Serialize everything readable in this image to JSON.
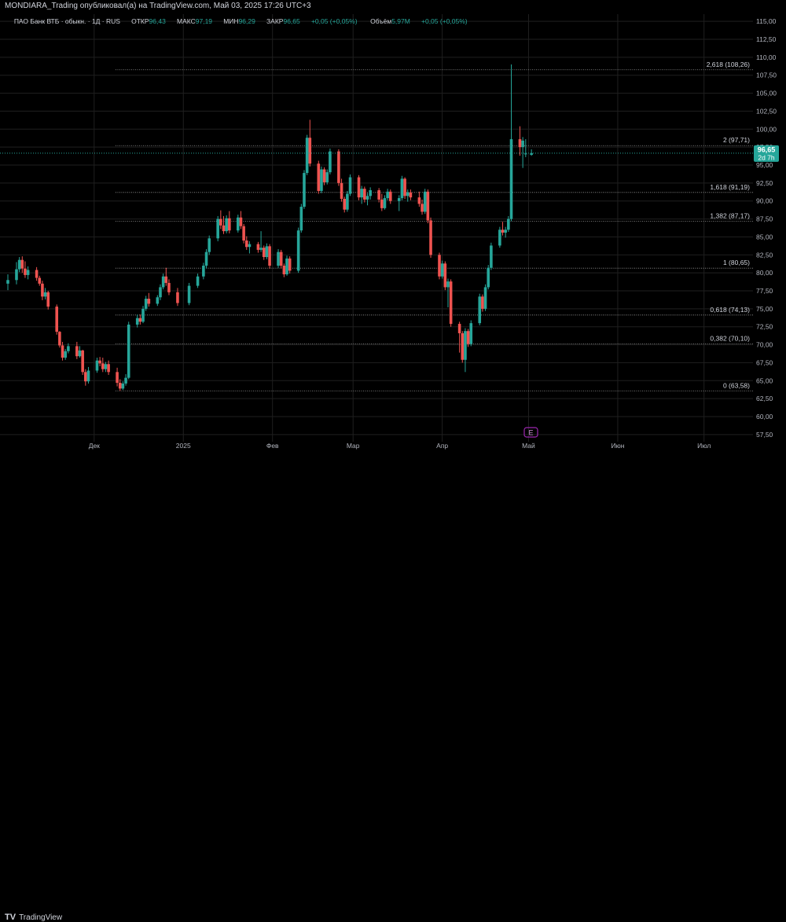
{
  "header": {
    "publish_line": "MONDIARA_Trading опубликовал(а) на TradingView.com, Май 03, 2025 17:26 UTC+3"
  },
  "legend": {
    "symbol": "ПАО Банк ВТБ · обыкн. · 1Д · RUS",
    "open_label": "ОТКР",
    "open_value": "96,43",
    "high_label": "МАКС",
    "high_value": "97,19",
    "low_label": "МИН",
    "low_value": "96,29",
    "close_label": "ЗАКР",
    "close_value": "96,65",
    "change": "+0,05 (+0,05%)",
    "volume_label": "Объём",
    "volume_value": "5,97M",
    "volume_change": "+0,05 (+0,05%)"
  },
  "price_badge": {
    "price": "96,65",
    "countdown": "2d 7h"
  },
  "earnings_marker": "E",
  "footer": {
    "brand": "TradingView"
  },
  "colors": {
    "up": "#26a69a",
    "down": "#ef5350",
    "grid": "#1f1f1f",
    "axis_text": "#b2b5be",
    "fib_line": "#9a9a9a",
    "badge_bg": "#26a69a",
    "earnings": "#9c27b0",
    "background": "#000000"
  },
  "chart_data": {
    "type": "candlestick",
    "title": "ПАО Банк ВТБ · обыкн. · 1Д · RUS",
    "yaxis": {
      "ylim": [
        56.5,
        116
      ],
      "ticks": [
        "57,50",
        "60,00",
        "62,50",
        "65,00",
        "67,50",
        "70,00",
        "72,50",
        "75,00",
        "77,50",
        "80,00",
        "82,50",
        "85,00",
        "87,50",
        "90,00",
        "92,50",
        "95,00",
        "97,50",
        "100,00",
        "102,50",
        "105,00",
        "107,50",
        "110,00",
        "112,50",
        "115,00"
      ],
      "position": "right"
    },
    "xaxis": {
      "month_labels": [
        {
          "label": "Дек",
          "date": "2024-12-01"
        },
        {
          "label": "2025",
          "date": "2025-01-01"
        },
        {
          "label": "Фев",
          "date": "2025-02-01"
        },
        {
          "label": "Мар",
          "date": "2025-03-01"
        },
        {
          "label": "Апр",
          "date": "2025-04-01"
        },
        {
          "label": "Май",
          "date": "2025-05-01"
        },
        {
          "label": "Июн",
          "date": "2025-06-01"
        },
        {
          "label": "Июл",
          "date": "2025-07-01"
        }
      ]
    },
    "fibonacci": [
      {
        "label": "2,618 (108,26)",
        "value": 108.26
      },
      {
        "label": "2 (97,71)",
        "value": 97.71
      },
      {
        "label": "1,618 (91,19)",
        "value": 91.19
      },
      {
        "label": "1,382 (87,17)",
        "value": 87.17
      },
      {
        "label": "1 (80,65)",
        "value": 80.65
      },
      {
        "label": "0,618 (74,13)",
        "value": 74.13
      },
      {
        "label": "0,382 (70,10)",
        "value": 70.1
      },
      {
        "label": "0 (63,58)",
        "value": 63.58
      }
    ],
    "last_price": 96.65,
    "candles": [
      {
        "d": "2024-11-01",
        "o": 78.5,
        "h": 79.8,
        "l": 77.6,
        "c": 79.0
      },
      {
        "d": "2024-11-04",
        "o": 79.0,
        "h": 81.5,
        "l": 78.4,
        "c": 80.5
      },
      {
        "d": "2024-11-05",
        "o": 80.5,
        "h": 82.2,
        "l": 80.1,
        "c": 81.8
      },
      {
        "d": "2024-11-06",
        "o": 81.8,
        "h": 82.3,
        "l": 80.0,
        "c": 80.6
      },
      {
        "d": "2024-11-07",
        "o": 80.6,
        "h": 81.6,
        "l": 79.3,
        "c": 79.7
      },
      {
        "d": "2024-11-08",
        "o": 79.7,
        "h": 80.9,
        "l": 79.1,
        "c": 80.4
      },
      {
        "d": "2024-11-11",
        "o": 80.4,
        "h": 80.8,
        "l": 78.9,
        "c": 79.3
      },
      {
        "d": "2024-11-12",
        "o": 79.3,
        "h": 79.6,
        "l": 78.2,
        "c": 78.5
      },
      {
        "d": "2024-11-13",
        "o": 78.5,
        "h": 78.9,
        "l": 76.2,
        "c": 76.7
      },
      {
        "d": "2024-11-14",
        "o": 76.7,
        "h": 77.9,
        "l": 76.3,
        "c": 77.3
      },
      {
        "d": "2024-11-15",
        "o": 77.3,
        "h": 77.5,
        "l": 74.9,
        "c": 75.3
      },
      {
        "d": "2024-11-18",
        "o": 75.3,
        "h": 75.6,
        "l": 71.4,
        "c": 71.8
      },
      {
        "d": "2024-11-19",
        "o": 71.8,
        "h": 71.9,
        "l": 69.6,
        "c": 69.9
      },
      {
        "d": "2024-11-20",
        "o": 69.9,
        "h": 70.4,
        "l": 67.8,
        "c": 68.2
      },
      {
        "d": "2024-11-21",
        "o": 68.2,
        "h": 69.4,
        "l": 67.9,
        "c": 69.1
      },
      {
        "d": "2024-11-22",
        "o": 69.1,
        "h": 70.2,
        "l": 68.8,
        "c": 69.8
      },
      {
        "d": "2024-11-25",
        "o": 69.8,
        "h": 70.4,
        "l": 68.0,
        "c": 68.4
      },
      {
        "d": "2024-11-26",
        "o": 68.4,
        "h": 69.8,
        "l": 68.2,
        "c": 69.2
      },
      {
        "d": "2024-11-27",
        "o": 69.2,
        "h": 69.3,
        "l": 65.8,
        "c": 66.2
      },
      {
        "d": "2024-11-28",
        "o": 66.2,
        "h": 66.6,
        "l": 64.3,
        "c": 64.9
      },
      {
        "d": "2024-11-29",
        "o": 64.9,
        "h": 66.9,
        "l": 64.6,
        "c": 66.4
      },
      {
        "d": "2024-12-02",
        "o": 66.4,
        "h": 68.2,
        "l": 66.1,
        "c": 67.8
      },
      {
        "d": "2024-12-03",
        "o": 67.8,
        "h": 68.3,
        "l": 67.0,
        "c": 67.4
      },
      {
        "d": "2024-12-04",
        "o": 67.4,
        "h": 68.2,
        "l": 66.2,
        "c": 66.6
      },
      {
        "d": "2024-12-05",
        "o": 66.6,
        "h": 67.6,
        "l": 66.2,
        "c": 67.3
      },
      {
        "d": "2024-12-06",
        "o": 67.3,
        "h": 67.8,
        "l": 65.8,
        "c": 66.2
      },
      {
        "d": "2024-12-09",
        "o": 66.2,
        "h": 66.8,
        "l": 64.2,
        "c": 64.7
      },
      {
        "d": "2024-12-10",
        "o": 64.7,
        "h": 65.2,
        "l": 63.58,
        "c": 63.9
      },
      {
        "d": "2024-12-11",
        "o": 63.9,
        "h": 64.9,
        "l": 63.7,
        "c": 64.6
      },
      {
        "d": "2024-12-12",
        "o": 64.6,
        "h": 65.9,
        "l": 64.3,
        "c": 65.4
      },
      {
        "d": "2024-12-13",
        "o": 65.4,
        "h": 73.2,
        "l": 65.2,
        "c": 72.8
      },
      {
        "d": "2024-12-16",
        "o": 72.8,
        "h": 74.2,
        "l": 72.4,
        "c": 73.7
      },
      {
        "d": "2024-12-17",
        "o": 73.7,
        "h": 74.2,
        "l": 72.8,
        "c": 73.2
      },
      {
        "d": "2024-12-18",
        "o": 73.2,
        "h": 75.4,
        "l": 73.0,
        "c": 75.0
      },
      {
        "d": "2024-12-19",
        "o": 75.0,
        "h": 76.8,
        "l": 74.7,
        "c": 76.4
      },
      {
        "d": "2024-12-20",
        "o": 76.4,
        "h": 77.2,
        "l": 75.3,
        "c": 75.7
      },
      {
        "d": "2024-12-23",
        "o": 75.7,
        "h": 76.9,
        "l": 75.4,
        "c": 76.6
      },
      {
        "d": "2024-12-24",
        "o": 76.6,
        "h": 78.4,
        "l": 76.2,
        "c": 78.0
      },
      {
        "d": "2024-12-25",
        "o": 78.0,
        "h": 79.9,
        "l": 77.7,
        "c": 79.5
      },
      {
        "d": "2024-12-26",
        "o": 79.5,
        "h": 80.7,
        "l": 78.2,
        "c": 78.6
      },
      {
        "d": "2024-12-27",
        "o": 78.6,
        "h": 79.1,
        "l": 76.9,
        "c": 77.3
      },
      {
        "d": "2024-12-30",
        "o": 77.3,
        "h": 77.9,
        "l": 75.4,
        "c": 75.8
      },
      {
        "d": "2025-01-03",
        "o": 75.8,
        "h": 78.6,
        "l": 75.5,
        "c": 78.2
      },
      {
        "d": "2025-01-06",
        "o": 78.2,
        "h": 79.9,
        "l": 77.9,
        "c": 79.5
      },
      {
        "d": "2025-01-08",
        "o": 79.5,
        "h": 81.4,
        "l": 79.1,
        "c": 81.0
      },
      {
        "d": "2025-01-09",
        "o": 81.0,
        "h": 83.3,
        "l": 80.6,
        "c": 82.9
      },
      {
        "d": "2025-01-10",
        "o": 82.9,
        "h": 85.2,
        "l": 82.5,
        "c": 84.8
      },
      {
        "d": "2025-01-13",
        "o": 84.8,
        "h": 87.9,
        "l": 84.4,
        "c": 87.5
      },
      {
        "d": "2025-01-14",
        "o": 87.5,
        "h": 88.7,
        "l": 86.1,
        "c": 86.6
      },
      {
        "d": "2025-01-15",
        "o": 86.6,
        "h": 87.9,
        "l": 85.4,
        "c": 85.8
      },
      {
        "d": "2025-01-16",
        "o": 85.8,
        "h": 88.0,
        "l": 85.5,
        "c": 87.6
      },
      {
        "d": "2025-01-17",
        "o": 87.6,
        "h": 88.6,
        "l": 85.5,
        "c": 85.9
      },
      {
        "d": "2025-01-20",
        "o": 85.9,
        "h": 88.1,
        "l": 85.6,
        "c": 87.7
      },
      {
        "d": "2025-01-21",
        "o": 87.7,
        "h": 88.6,
        "l": 86.1,
        "c": 86.5
      },
      {
        "d": "2025-01-22",
        "o": 86.5,
        "h": 86.8,
        "l": 84.1,
        "c": 84.5
      },
      {
        "d": "2025-01-23",
        "o": 84.5,
        "h": 85.1,
        "l": 83.2,
        "c": 83.6
      },
      {
        "d": "2025-01-24",
        "o": 83.6,
        "h": 84.4,
        "l": 82.7,
        "c": 84.0
      },
      {
        "d": "2025-01-27",
        "o": 84.0,
        "h": 84.3,
        "l": 82.8,
        "c": 83.2
      },
      {
        "d": "2025-01-28",
        "o": 83.2,
        "h": 85.8,
        "l": 82.9,
        "c": 83.5
      },
      {
        "d": "2025-01-29",
        "o": 83.5,
        "h": 83.8,
        "l": 81.8,
        "c": 82.2
      },
      {
        "d": "2025-01-30",
        "o": 82.2,
        "h": 84.1,
        "l": 81.9,
        "c": 83.7
      },
      {
        "d": "2025-01-31",
        "o": 83.7,
        "h": 84.0,
        "l": 80.6,
        "c": 81.0
      },
      {
        "d": "2025-02-03",
        "o": 81.0,
        "h": 83.3,
        "l": 80.7,
        "c": 82.9
      },
      {
        "d": "2025-02-04",
        "o": 82.9,
        "h": 83.2,
        "l": 80.6,
        "c": 81.0
      },
      {
        "d": "2025-02-05",
        "o": 81.0,
        "h": 81.3,
        "l": 79.4,
        "c": 79.8
      },
      {
        "d": "2025-02-06",
        "o": 79.8,
        "h": 82.4,
        "l": 79.6,
        "c": 82.0
      },
      {
        "d": "2025-02-07",
        "o": 82.0,
        "h": 82.3,
        "l": 79.9,
        "c": 80.3
      },
      {
        "d": "2025-02-10",
        "o": 80.3,
        "h": 86.3,
        "l": 80.0,
        "c": 85.9
      },
      {
        "d": "2025-02-11",
        "o": 85.9,
        "h": 89.6,
        "l": 85.6,
        "c": 89.2
      },
      {
        "d": "2025-02-12",
        "o": 89.2,
        "h": 94.3,
        "l": 88.9,
        "c": 93.9
      },
      {
        "d": "2025-02-13",
        "o": 93.9,
        "h": 99.2,
        "l": 93.6,
        "c": 98.8
      },
      {
        "d": "2025-02-14",
        "o": 98.8,
        "h": 101.3,
        "l": 94.8,
        "c": 95.2
      },
      {
        "d": "2025-02-17",
        "o": 95.2,
        "h": 95.6,
        "l": 91.0,
        "c": 91.4
      },
      {
        "d": "2025-02-18",
        "o": 91.4,
        "h": 94.8,
        "l": 91.1,
        "c": 94.4
      },
      {
        "d": "2025-02-19",
        "o": 94.4,
        "h": 94.7,
        "l": 92.2,
        "c": 92.6
      },
      {
        "d": "2025-02-20",
        "o": 92.6,
        "h": 94.4,
        "l": 92.3,
        "c": 94.0
      },
      {
        "d": "2025-02-21",
        "o": 94.0,
        "h": 97.3,
        "l": 93.7,
        "c": 96.9
      },
      {
        "d": "2025-02-24",
        "o": 96.9,
        "h": 97.2,
        "l": 92.1,
        "c": 92.5
      },
      {
        "d": "2025-02-25",
        "o": 92.5,
        "h": 93.1,
        "l": 89.9,
        "c": 90.3
      },
      {
        "d": "2025-02-26",
        "o": 90.3,
        "h": 90.6,
        "l": 88.4,
        "c": 88.8
      },
      {
        "d": "2025-02-27",
        "o": 88.8,
        "h": 91.4,
        "l": 88.5,
        "c": 91.0
      },
      {
        "d": "2025-02-28",
        "o": 91.0,
        "h": 93.7,
        "l": 90.7,
        "c": 93.3
      },
      {
        "d": "2025-03-03",
        "o": 93.3,
        "h": 93.6,
        "l": 90.1,
        "c": 90.5
      },
      {
        "d": "2025-03-04",
        "o": 90.5,
        "h": 92.1,
        "l": 89.6,
        "c": 91.7
      },
      {
        "d": "2025-03-05",
        "o": 91.7,
        "h": 92.0,
        "l": 89.8,
        "c": 90.2
      },
      {
        "d": "2025-03-06",
        "o": 90.2,
        "h": 91.1,
        "l": 89.4,
        "c": 90.7
      },
      {
        "d": "2025-03-07",
        "o": 90.7,
        "h": 91.9,
        "l": 90.2,
        "c": 91.5
      },
      {
        "d": "2025-03-10",
        "o": 91.5,
        "h": 91.8,
        "l": 89.8,
        "c": 90.2
      },
      {
        "d": "2025-03-11",
        "o": 90.2,
        "h": 91.0,
        "l": 88.6,
        "c": 89.0
      },
      {
        "d": "2025-03-12",
        "o": 89.0,
        "h": 90.8,
        "l": 88.8,
        "c": 90.4
      },
      {
        "d": "2025-03-13",
        "o": 90.4,
        "h": 91.7,
        "l": 90.1,
        "c": 91.3
      },
      {
        "d": "2025-03-14",
        "o": 91.3,
        "h": 91.6,
        "l": 89.6,
        "c": 90.0
      },
      {
        "d": "2025-03-17",
        "o": 90.0,
        "h": 90.8,
        "l": 88.6,
        "c": 90.4
      },
      {
        "d": "2025-03-18",
        "o": 90.4,
        "h": 93.5,
        "l": 90.1,
        "c": 93.1
      },
      {
        "d": "2025-03-19",
        "o": 93.1,
        "h": 93.3,
        "l": 90.3,
        "c": 90.7
      },
      {
        "d": "2025-03-20",
        "o": 90.7,
        "h": 91.6,
        "l": 89.9,
        "c": 91.2
      },
      {
        "d": "2025-03-21",
        "o": 91.2,
        "h": 91.6,
        "l": 90.1,
        "c": 90.5
      },
      {
        "d": "2025-03-24",
        "o": 90.5,
        "h": 91.3,
        "l": 89.2,
        "c": 89.6
      },
      {
        "d": "2025-03-25",
        "o": 89.6,
        "h": 90.2,
        "l": 88.1,
        "c": 88.5
      },
      {
        "d": "2025-03-26",
        "o": 88.5,
        "h": 91.7,
        "l": 88.2,
        "c": 91.3
      },
      {
        "d": "2025-03-27",
        "o": 91.3,
        "h": 91.6,
        "l": 86.9,
        "c": 87.3
      },
      {
        "d": "2025-03-28",
        "o": 87.3,
        "h": 87.7,
        "l": 82.1,
        "c": 82.5
      },
      {
        "d": "2025-03-31",
        "o": 82.5,
        "h": 82.8,
        "l": 79.1,
        "c": 79.5
      },
      {
        "d": "2025-04-01",
        "o": 79.5,
        "h": 81.7,
        "l": 79.2,
        "c": 81.3
      },
      {
        "d": "2025-04-02",
        "o": 81.3,
        "h": 81.6,
        "l": 77.6,
        "c": 78.0
      },
      {
        "d": "2025-04-03",
        "o": 78.0,
        "h": 79.2,
        "l": 75.2,
        "c": 78.8
      },
      {
        "d": "2025-04-04",
        "o": 78.8,
        "h": 79.1,
        "l": 72.5,
        "c": 72.9
      },
      {
        "d": "2025-04-07",
        "o": 72.9,
        "h": 73.2,
        "l": 68.9,
        "c": 71.6
      },
      {
        "d": "2025-04-08",
        "o": 71.6,
        "h": 71.9,
        "l": 67.5,
        "c": 67.9
      },
      {
        "d": "2025-04-09",
        "o": 67.9,
        "h": 72.3,
        "l": 66.2,
        "c": 71.9
      },
      {
        "d": "2025-04-10",
        "o": 71.9,
        "h": 72.2,
        "l": 69.7,
        "c": 70.1
      },
      {
        "d": "2025-04-11",
        "o": 70.1,
        "h": 73.4,
        "l": 69.8,
        "c": 73.0
      },
      {
        "d": "2025-04-14",
        "o": 73.0,
        "h": 77.1,
        "l": 72.7,
        "c": 76.7
      },
      {
        "d": "2025-04-15",
        "o": 76.7,
        "h": 77.0,
        "l": 74.6,
        "c": 75.0
      },
      {
        "d": "2025-04-16",
        "o": 75.0,
        "h": 78.4,
        "l": 74.7,
        "c": 78.0
      },
      {
        "d": "2025-04-17",
        "o": 78.0,
        "h": 81.1,
        "l": 77.7,
        "c": 80.7
      },
      {
        "d": "2025-04-18",
        "o": 80.7,
        "h": 84.2,
        "l": 80.4,
        "c": 83.8
      },
      {
        "d": "2025-04-21",
        "o": 83.8,
        "h": 86.4,
        "l": 83.5,
        "c": 86.0
      },
      {
        "d": "2025-04-22",
        "o": 86.0,
        "h": 87.1,
        "l": 85.2,
        "c": 85.6
      },
      {
        "d": "2025-04-23",
        "o": 85.6,
        "h": 86.4,
        "l": 84.9,
        "c": 86.0
      },
      {
        "d": "2025-04-24",
        "o": 86.0,
        "h": 87.9,
        "l": 85.7,
        "c": 87.5
      },
      {
        "d": "2025-04-25",
        "o": 87.5,
        "h": 109.0,
        "l": 87.2,
        "c": 98.6
      },
      {
        "d": "2025-04-28",
        "o": 98.6,
        "h": 100.4,
        "l": 96.3,
        "c": 97.5
      },
      {
        "d": "2025-04-29",
        "o": 97.5,
        "h": 98.9,
        "l": 94.6,
        "c": 98.4
      },
      {
        "d": "2025-04-30",
        "o": 96.6,
        "h": 98.6,
        "l": 96.1,
        "c": 96.6
      },
      {
        "d": "2025-05-02",
        "o": 96.43,
        "h": 97.19,
        "l": 96.29,
        "c": 96.65
      }
    ]
  }
}
